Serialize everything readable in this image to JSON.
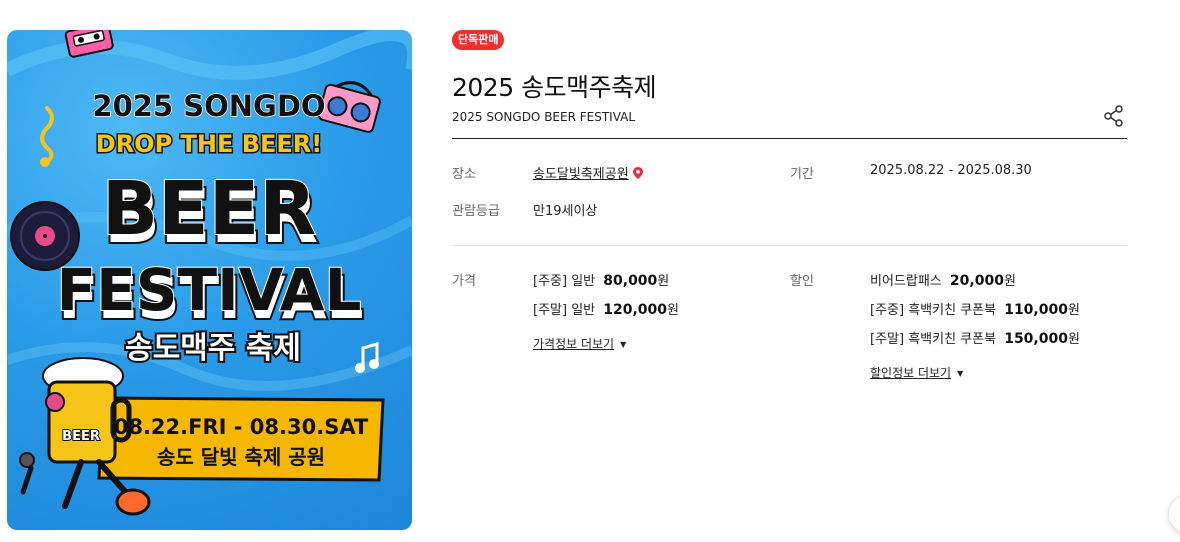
{
  "poster": {
    "year_line": "2025 SONGDO",
    "slogan": "DROP THE BEER!",
    "word1": "BEER",
    "word2": "FESTIVAL",
    "korean_title": "송도맥주 축제",
    "dates_line": "08.22.FRI - 08.30.SAT",
    "venue_line": "송도 달빛 축제 공원",
    "cup_label": "BEER",
    "colors": {
      "background": "#2a9be8",
      "accent_yellow": "#f5c518",
      "banner": "#f5b700"
    }
  },
  "badge": "단독판매",
  "title": "2025 송도맥주축제",
  "subtitle": "2025 SONGDO BEER FESTIVAL",
  "info": {
    "place_label": "장소",
    "place_value": "송도달빛축제공원",
    "period_label": "기간",
    "period_value": "2025.08.22 - 2025.08.30",
    "rating_label": "관람등급",
    "rating_value": "만19세이상"
  },
  "price": {
    "label": "가격",
    "rows": [
      {
        "name": "[주중] 일반",
        "amount": "80,000",
        "unit": "원"
      },
      {
        "name": "[주말] 일반",
        "amount": "120,000",
        "unit": "원"
      }
    ],
    "more_label": "가격정보 더보기"
  },
  "discount": {
    "label": "할인",
    "rows": [
      {
        "name": "비어드랍패스",
        "amount": "20,000",
        "unit": "원"
      },
      {
        "name": "[주중] 흑백키친 쿠폰북",
        "amount": "110,000",
        "unit": "원"
      },
      {
        "name": "[주말] 흑백키친 쿠폰북",
        "amount": "150,000",
        "unit": "원"
      }
    ],
    "more_label": "할인정보 더보기"
  },
  "icons": {
    "share": "share-icon",
    "map_pin": "map-pin-icon",
    "caret": "caret-down-icon"
  }
}
